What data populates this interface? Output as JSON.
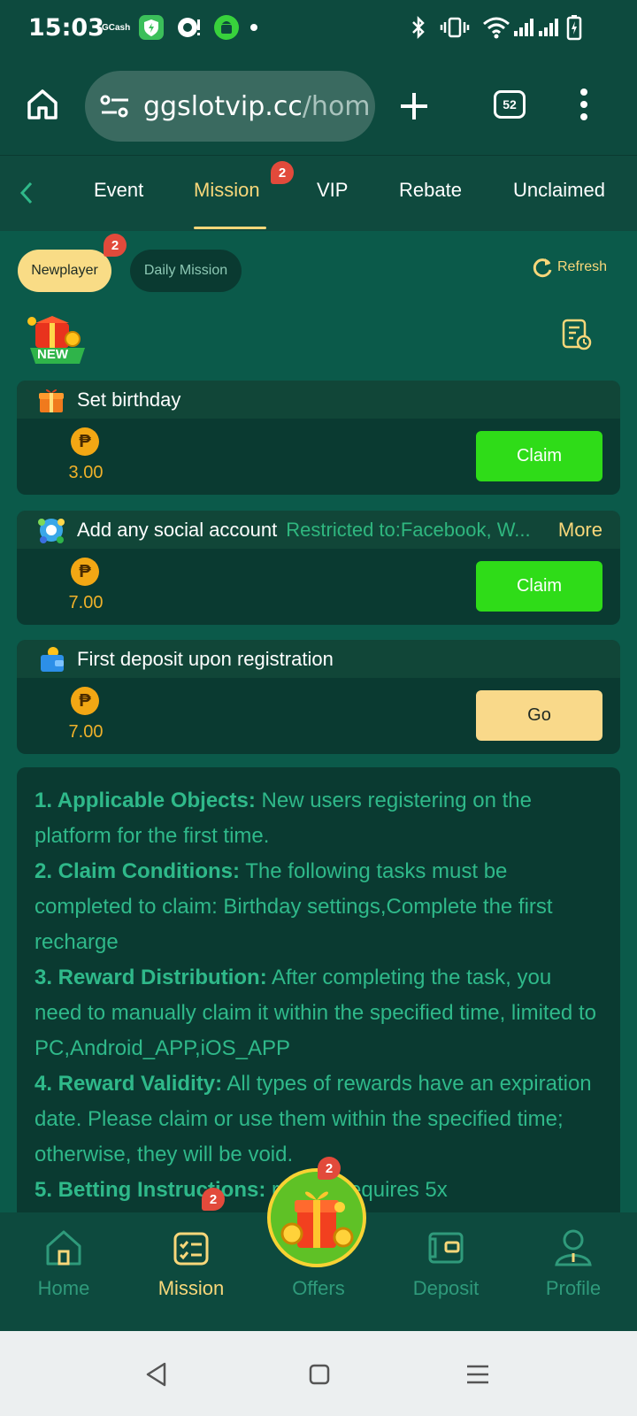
{
  "status_bar": {
    "time": "15:03",
    "gcash_label": "GCash"
  },
  "browser": {
    "url_host": "ggslotvip.cc",
    "url_path": "/hom",
    "tab_count": "52"
  },
  "tabs": {
    "items": [
      {
        "label": "Event"
      },
      {
        "label": "Mission",
        "badge": "2"
      },
      {
        "label": "VIP"
      },
      {
        "label": "Rebate"
      },
      {
        "label": "Unclaimed"
      }
    ]
  },
  "subtabs": {
    "newplayer": "Newplayer",
    "newplayer_badge": "2",
    "daily": "Daily Mission",
    "refresh": "Refresh"
  },
  "new_badge_text": "NEW",
  "tasks": [
    {
      "name": "Set birthday",
      "amount": "3.00",
      "button": "Claim",
      "icon": "gift-icon"
    },
    {
      "name": "Add any social account",
      "restriction": "Restricted to:Facebook, W...",
      "more": "More",
      "amount": "7.00",
      "button": "Claim",
      "icon": "social-icon"
    },
    {
      "name": "First deposit upon registration",
      "amount": "7.00",
      "button": "Go",
      "icon": "wallet-icon"
    }
  ],
  "currency_symbol": "₱",
  "rules": [
    {
      "title": "1. Applicable Objects:",
      "text": " New users registering on the platform for the first time."
    },
    {
      "title": "2. Claim Conditions:",
      "text": " The following tasks must be completed to claim: Birthday settings,Complete the first recharge"
    },
    {
      "title": "3. Reward Distribution:",
      "text": " After completing the task, you need to manually claim it within the specified time, limited to PC,Android_APP,iOS_APP"
    },
    {
      "title": "4. Reward Validity:",
      "text": " All types of rewards have an expiration date. Please claim or use them within the specified time; otherwise, they will be void."
    },
    {
      "title": "5. Betting Instructions:",
      "text": " reward requires 5x"
    }
  ],
  "bottom_nav": {
    "home": "Home",
    "mission": "Mission",
    "mission_badge": "2",
    "offers": "Offers",
    "offers_badge": "2",
    "deposit": "Deposit",
    "profile": "Profile"
  },
  "colors": {
    "accent": "#f8d77a",
    "claim": "#2fdc18",
    "bg": "#0b5a4a"
  }
}
